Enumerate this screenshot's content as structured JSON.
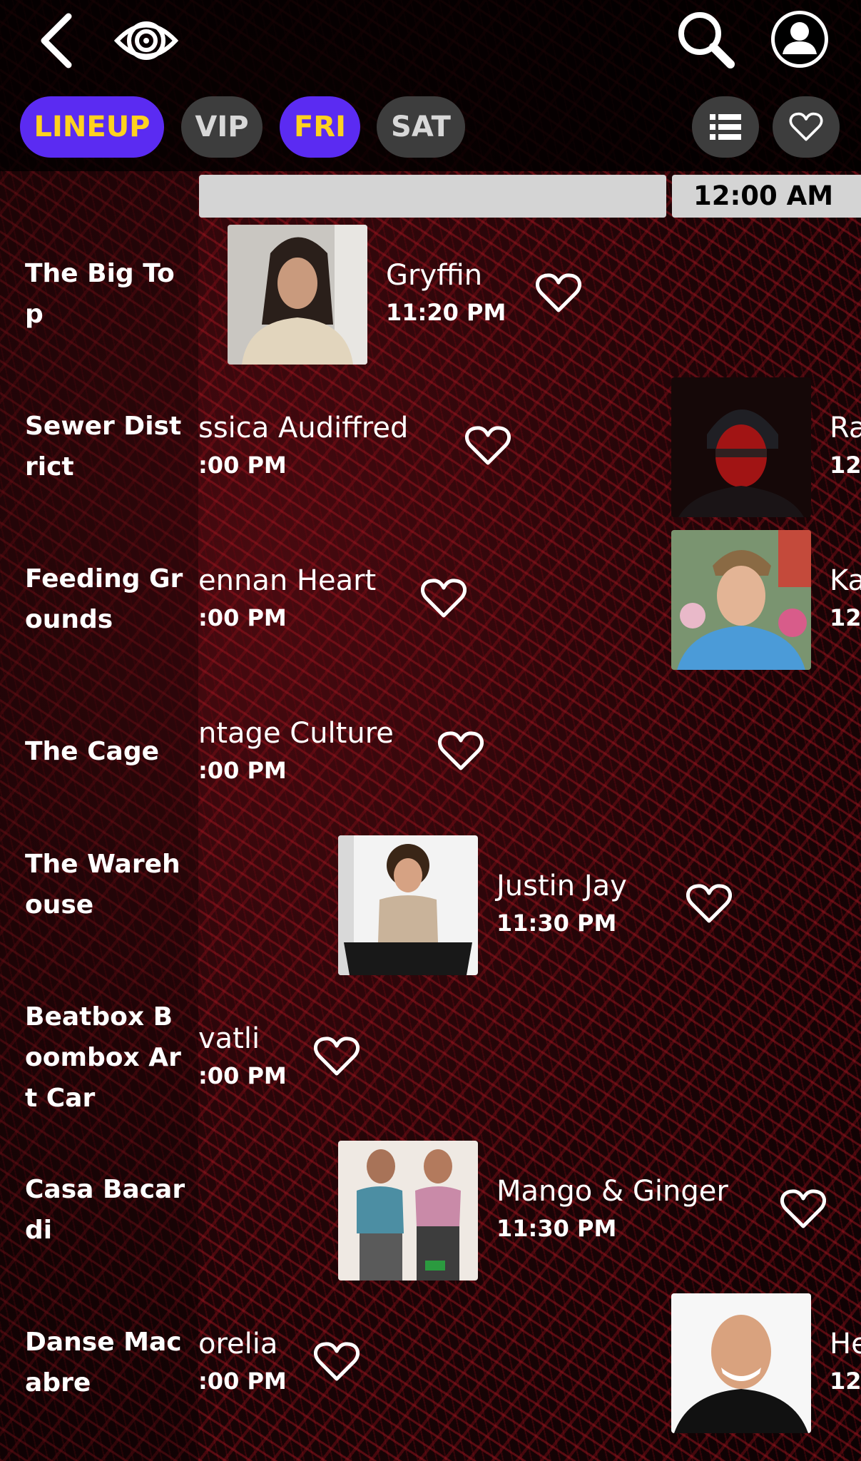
{
  "header": {
    "tabs": [
      {
        "label": "LINEUP",
        "active": true
      },
      {
        "label": "VIP",
        "active": false
      },
      {
        "label": "FRI",
        "active": true
      },
      {
        "label": "SAT",
        "active": false
      }
    ]
  },
  "timeline": {
    "current_time_label": "12:00 AM"
  },
  "stages": [
    {
      "name": "The Big Top"
    },
    {
      "name": "Sewer District"
    },
    {
      "name": "Feeding Grounds"
    },
    {
      "name": "The Cage"
    },
    {
      "name": "The Warehouse"
    },
    {
      "name": "Beatbox Boombox Art Car"
    },
    {
      "name": "Casa Bacardi"
    },
    {
      "name": "Danse Macabre"
    }
  ],
  "acts": {
    "gryffin": {
      "name": "Gryffin",
      "time": "11:20 PM"
    },
    "audiffred": {
      "name": "ssica Audiffred",
      "time": ":00 PM"
    },
    "sewer_next": {
      "name": "Ra",
      "time": "12"
    },
    "heart": {
      "name": "ennan Heart",
      "time": ":00 PM"
    },
    "feeding_next": {
      "name": "Ka",
      "time": "12"
    },
    "vintage": {
      "name": "ntage Culture",
      "time": ":00 PM"
    },
    "justin": {
      "name": "Justin Jay",
      "time": "11:30 PM"
    },
    "vatli": {
      "name": "vatli",
      "time": ":00 PM"
    },
    "mango": {
      "name": "Mango & Ginger",
      "time": "11:30 PM"
    },
    "orelia": {
      "name": "orelia",
      "time": ":00 PM"
    },
    "danse_next": {
      "name": "He",
      "time": "12"
    }
  },
  "colors": {
    "active_tab_bg": "#5b2bf2",
    "active_tab_text": "#ffd21f",
    "inactive_tab_bg": "#3d3d3d",
    "time_strip": "#d4d4d4"
  },
  "icons": [
    "back-chevron-icon",
    "eye-logo-icon",
    "search-icon",
    "profile-icon",
    "list-icon",
    "heart-icon"
  ]
}
